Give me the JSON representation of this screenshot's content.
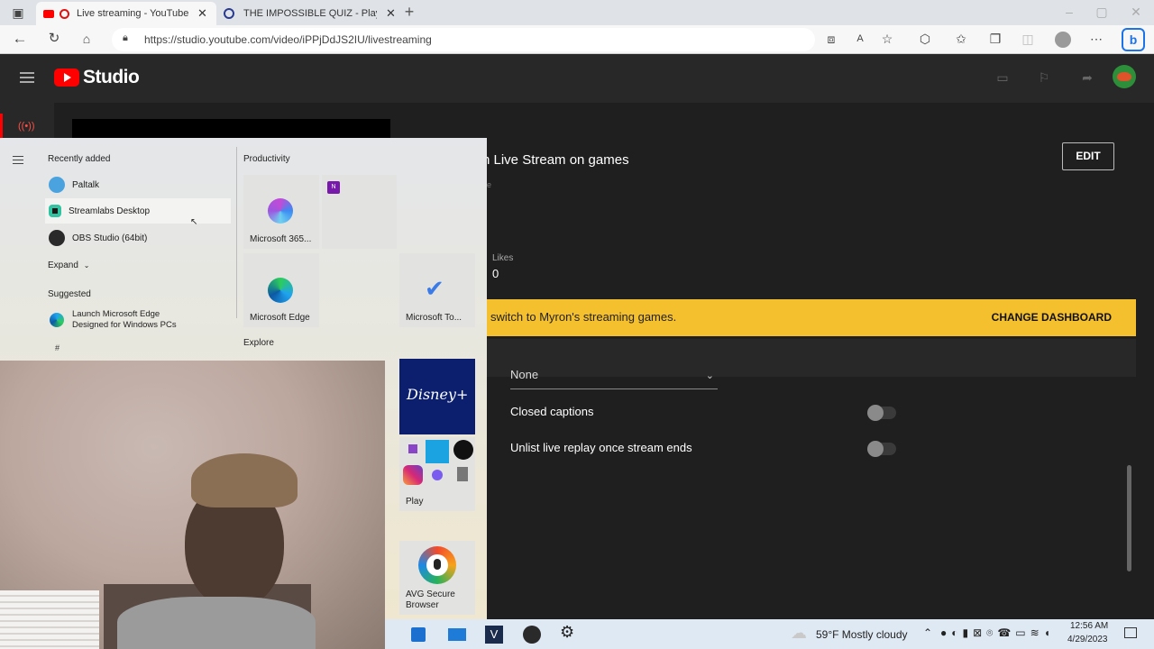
{
  "browser": {
    "tabs": [
      {
        "label": "Live streaming - YouTube St",
        "active": true
      },
      {
        "label": "THE IMPOSSIBLE QUIZ - Play The",
        "active": false
      }
    ],
    "url": "https://studio.youtube.com/video/iPPjDdJS2IU/livestreaming"
  },
  "studio": {
    "logo_text": "Studio",
    "stream_title": "n Live Stream on games",
    "edit_label": "EDIT",
    "likes_label": "Likes",
    "likes_value": "0",
    "banner_prefix": "switch to ",
    "banner_channel": "Myron's streaming games.",
    "change_dashboard_label": "CHANGE DASHBOARD",
    "dropdown_value": "None",
    "closed_captions_label": "Closed captions",
    "unlist_label": "Unlist live replay once stream ends",
    "colors": {
      "banner": "#f5c02e",
      "brand_red": "#ff0000"
    }
  },
  "start_menu": {
    "recently_added_label": "Recently added",
    "recent_apps": [
      "Paltalk",
      "Streamlabs Desktop",
      "OBS Studio (64bit)"
    ],
    "expand_label": "Expand",
    "suggested_label": "Suggested",
    "suggested_line1": "Launch Microsoft Edge",
    "suggested_line2": "Designed for Windows PCs",
    "hash_label": "#",
    "productivity_label": "Productivity",
    "tiles": {
      "m365": "Microsoft 365...",
      "edge": "Microsoft Edge",
      "todo": "Microsoft To...",
      "play": "Play",
      "avg_line1": "AVG Secure",
      "avg_line2": "Browser",
      "disney": "Disney+"
    },
    "explore_label": "Explore"
  },
  "taskbar": {
    "weather": "59°F  Mostly cloudy",
    "time": "12:56 AM",
    "date": "4/29/2023"
  }
}
